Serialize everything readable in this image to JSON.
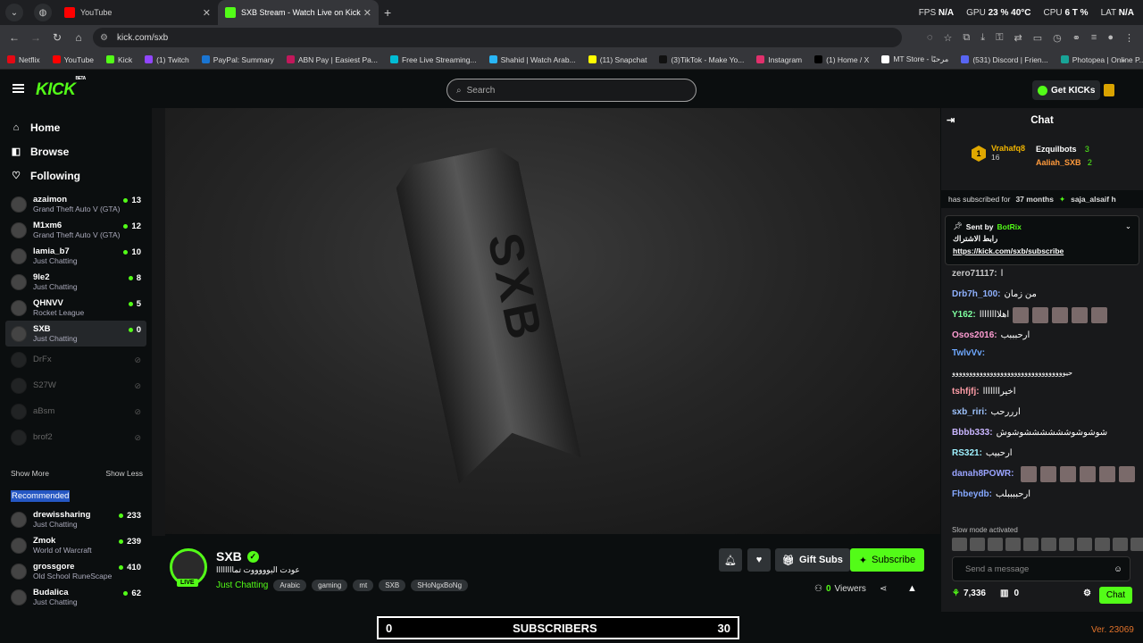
{
  "browser": {
    "tabs": [
      {
        "title": "YouTube",
        "icon": "youtube-icon",
        "color": "#ff0000"
      },
      {
        "title": "SXB Stream - Watch Live on Kick",
        "icon": "kick-icon",
        "color": "#53fc18"
      }
    ],
    "url": "kick.com/sxb",
    "perf": {
      "fps_label": "FPS",
      "fps": "N/A",
      "gpu_label": "GPU",
      "gpu": "23 % 40°C",
      "cpu_label": "CPU",
      "cpu": "6 T %",
      "lat_label": "LAT",
      "lat": "N/A"
    },
    "bookmarks": [
      {
        "label": "Netflix",
        "color": "#e50914"
      },
      {
        "label": "YouTube",
        "color": "#ff0000"
      },
      {
        "label": "Kick",
        "color": "#53fc18"
      },
      {
        "label": "(1) Twitch",
        "color": "#9146ff"
      },
      {
        "label": "PayPal: Summary",
        "color": "#1a75d2"
      },
      {
        "label": "ABN Pay | Easiest Pa...",
        "color": "#c2185b"
      },
      {
        "label": "Free Live Streaming...",
        "color": "#00bcd4"
      },
      {
        "label": "Shahid | Watch Arab...",
        "color": "#29b6f6"
      },
      {
        "label": "(11) Snapchat",
        "color": "#fffc00"
      },
      {
        "label": "(3)TikTok - Make Yo...",
        "color": "#111111"
      },
      {
        "label": "Instagram",
        "color": "#e1306c"
      },
      {
        "label": "(1) Home / X",
        "color": "#000000"
      },
      {
        "label": "MT Store - مرحبًا",
        "color": "#ffffff"
      },
      {
        "label": "(531) Discord | Frien...",
        "color": "#5865f2"
      },
      {
        "label": "Photopea | Online P...",
        "color": "#18a497"
      }
    ]
  },
  "header": {
    "logo": "KICK",
    "beta": "BETA",
    "search_placeholder": "Search",
    "get_kicks": "Get KICKs"
  },
  "sidebar": {
    "nav": [
      {
        "label": "Home",
        "icon": "home-icon"
      },
      {
        "label": "Browse",
        "icon": "browse-icon"
      },
      {
        "label": "Following",
        "icon": "heart-icon"
      }
    ],
    "following": [
      {
        "name": "azaimon",
        "cat": "Grand Theft Auto V (GTA)",
        "count": "13"
      },
      {
        "name": "M1xm6",
        "cat": "Grand Theft Auto V (GTA)",
        "count": "12"
      },
      {
        "name": "lamia_b7",
        "cat": "Just Chatting",
        "count": "10"
      },
      {
        "name": "9le2",
        "cat": "Just Chatting",
        "count": "8"
      },
      {
        "name": "QHNVV",
        "cat": "Rocket League",
        "count": "5"
      },
      {
        "name": "SXB",
        "cat": "Just Chatting",
        "count": "0"
      }
    ],
    "offline": [
      "DrFx",
      "S27W",
      "aBsm",
      "brof2"
    ],
    "show_more": "Show More",
    "show_less": "Show Less",
    "recommended_title": "Recommended",
    "recommended": [
      {
        "name": "drewissharing",
        "cat": "Just Chatting",
        "count": "233"
      },
      {
        "name": "Zmok",
        "cat": "World of Warcraft",
        "count": "239"
      },
      {
        "name": "grossgore",
        "cat": "Old School RuneScape",
        "count": "410"
      },
      {
        "name": "Budalica",
        "cat": "Just Chatting",
        "count": "62"
      }
    ]
  },
  "stream": {
    "channel": "SXB",
    "live": "LIVE",
    "title": "عودت اليوووووت تماااااااا",
    "category": "Just Chatting",
    "tags": [
      "Arabic",
      "gaming",
      "mt",
      "SXB",
      "SHoNgxBoNg"
    ],
    "gift_subs": "Gift Subs",
    "subscribe": "Subscribe",
    "viewers_count": "0",
    "viewers_label": "Viewers"
  },
  "chat": {
    "title": "Chat",
    "leaders": [
      {
        "rank": "1",
        "name": "Vrahafq8",
        "count": "16"
      },
      {
        "name": "Ezquilbots",
        "count": "3"
      },
      {
        "name": "Aaliah_SXB",
        "count": "2"
      }
    ],
    "sub_banner": {
      "text": "has subscribed for",
      "months": "37 months",
      "user": "saja_alsaif h"
    },
    "pinned": {
      "sent_by": "Sent by",
      "bot": "BotRix",
      "text": "رابط الاشتراك",
      "link": "https://kick.com/sxb/subscribe"
    },
    "messages": [
      {
        "user": "zero71117",
        "text": "ا",
        "color": "#c8c8c8"
      },
      {
        "user": "Drb7h_100",
        "text": "من زمان",
        "color": "#8fb1ff"
      },
      {
        "user": "Y162",
        "text": "اهلاااااااا",
        "color": "#7fffa0"
      },
      {
        "user": "Osos2016",
        "text": "ارحبببب",
        "color": "#ff9dd3"
      },
      {
        "user": "TwlvVv",
        "text": "حيووووووووووووووووووووووووووووووووو",
        "color": "#6ea8ff"
      },
      {
        "user": "tshfjfj",
        "text": "اخيرااااااا",
        "color": "#ff9da7"
      },
      {
        "user": "sxb_riri",
        "text": "ارررحب",
        "color": "#9fc4ff"
      },
      {
        "user": "Bbbb333",
        "text": "شوشوشوششششششوشوش",
        "color": "#c9b5ff"
      },
      {
        "user": "RS321",
        "text": "ارحبيب",
        "color": "#9ff1ff"
      },
      {
        "user": "danah8POWR",
        "text": "",
        "color": "#9aa4ff"
      },
      {
        "user": "Fhbeydb",
        "text": "ارحببببلب",
        "color": "#85a8ff"
      }
    ],
    "slow_mode": "Slow mode activated",
    "send_placeholder": "Send a message",
    "points": "7,336",
    "gifts": "0",
    "chat_button": "Chat"
  },
  "subgoal": {
    "current": "0",
    "label": "SUBSCRIBERS",
    "target": "30"
  },
  "version": "Ver. 23069"
}
